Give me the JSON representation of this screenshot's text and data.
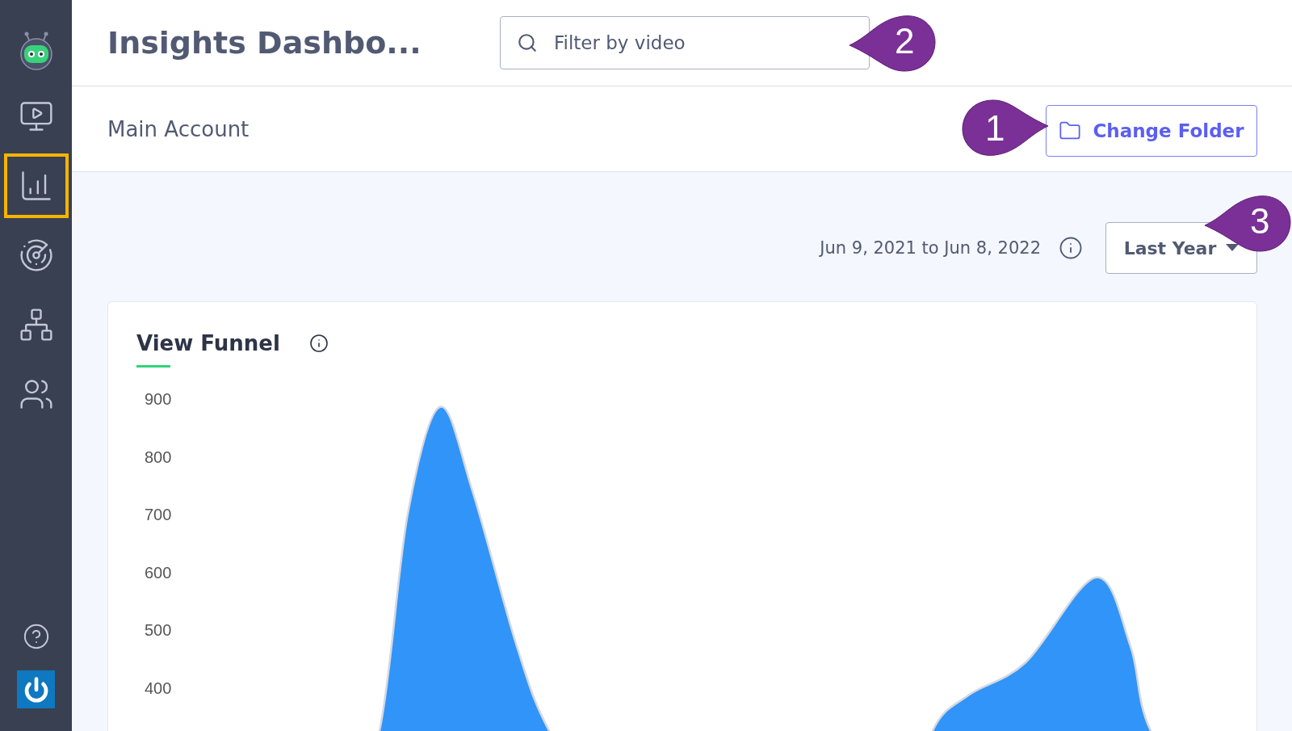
{
  "sidebar": {
    "items": [
      {
        "kind": "video",
        "selected": false
      },
      {
        "kind": "analytics",
        "selected": true
      },
      {
        "kind": "target",
        "selected": false
      },
      {
        "kind": "network",
        "selected": false
      },
      {
        "kind": "people",
        "selected": false
      }
    ],
    "bottom": [
      {
        "kind": "help"
      },
      {
        "kind": "power"
      }
    ]
  },
  "header": {
    "title": "Insights Dashbo...",
    "search": {
      "placeholder": "Filter by video"
    }
  },
  "account": {
    "name": "Main Account",
    "button": "Change Folder"
  },
  "range": {
    "text": "Jun 9, 2021 to Jun 8, 2022",
    "dropdown": "Last Year"
  },
  "card": {
    "title": "View Funnel",
    "y_axis_labels": [
      "900",
      "800",
      "700",
      "600",
      "500",
      "400"
    ]
  },
  "callouts": [
    {
      "number": "2"
    },
    {
      "number": "1"
    },
    {
      "number": "3"
    }
  ]
}
